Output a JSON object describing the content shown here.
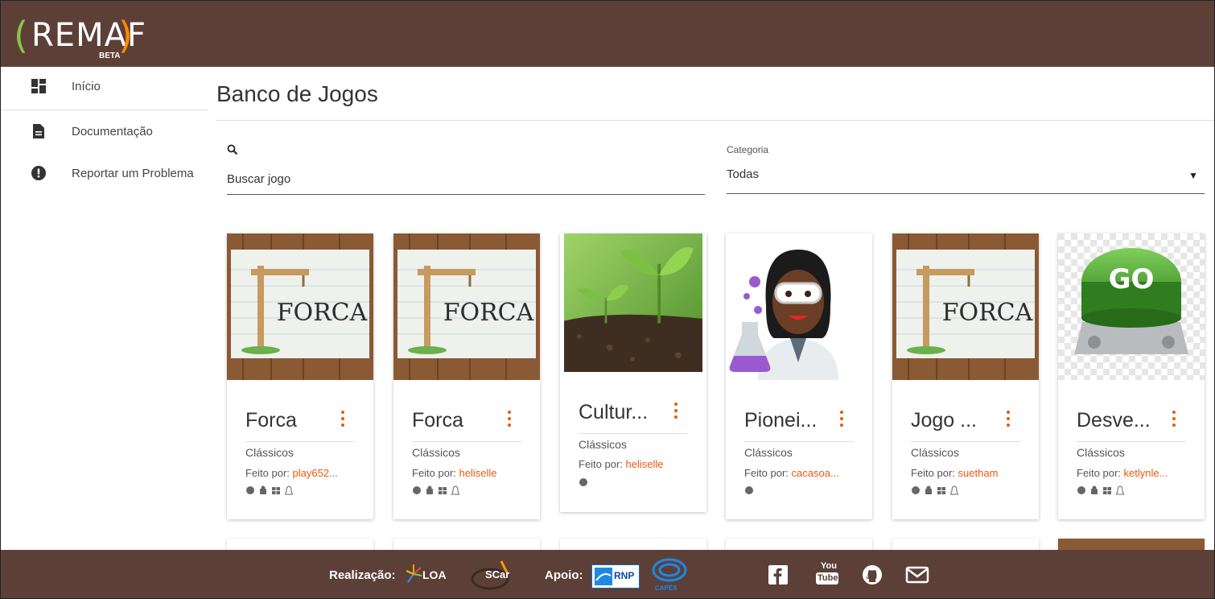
{
  "app": {
    "logo_text": "REMAF",
    "logo_badge": "BETA"
  },
  "sidebar": {
    "items": [
      {
        "label": "Início",
        "icon": "dashboard-icon"
      },
      {
        "label": "Documentação",
        "icon": "document-icon"
      },
      {
        "label": "Reportar um Problema",
        "icon": "alert-icon"
      }
    ]
  },
  "main": {
    "title": "Banco de Jogos",
    "search": {
      "placeholder": "Buscar jogo"
    },
    "category": {
      "label": "Categoria",
      "value": "Todas"
    }
  },
  "cards": [
    {
      "title": "Forca",
      "category": "Clássicos",
      "by_label": "Feito por:",
      "author": "play652...",
      "image": "forca"
    },
    {
      "title": "Forca",
      "category": "Clássicos",
      "by_label": "Feito por:",
      "author": "heliselle",
      "image": "forca"
    },
    {
      "title": "Cultur...",
      "category": "Clássicos",
      "by_label": "Feito por:",
      "author": "heliselle",
      "image": "sprouts"
    },
    {
      "title": "Pionei...",
      "category": "Clássicos",
      "by_label": "Feito por:",
      "author": "cacasoa...",
      "image": "scientist"
    },
    {
      "title": "Jogo ...",
      "category": "Clássicos",
      "by_label": "Feito por:",
      "author": "suetham",
      "image": "forca"
    },
    {
      "title": "Desve...",
      "category": "Clássicos",
      "by_label": "Feito por:",
      "author": "ketlynle...",
      "image": "go-button"
    }
  ],
  "forca_text": "FORCA",
  "go_text": "GO",
  "footer": {
    "realizacao": "Realização:",
    "apoio": "Apoio:",
    "loa": "LOA",
    "ufscar": "SCar",
    "rnp": "RNP",
    "capes": "CAPES",
    "youtube_top": "You",
    "youtube_bottom": "Tube"
  },
  "colors": {
    "brand_brown": "#5c4037",
    "accent_orange": "#e8590c",
    "logo_green": "#8bc34a"
  }
}
